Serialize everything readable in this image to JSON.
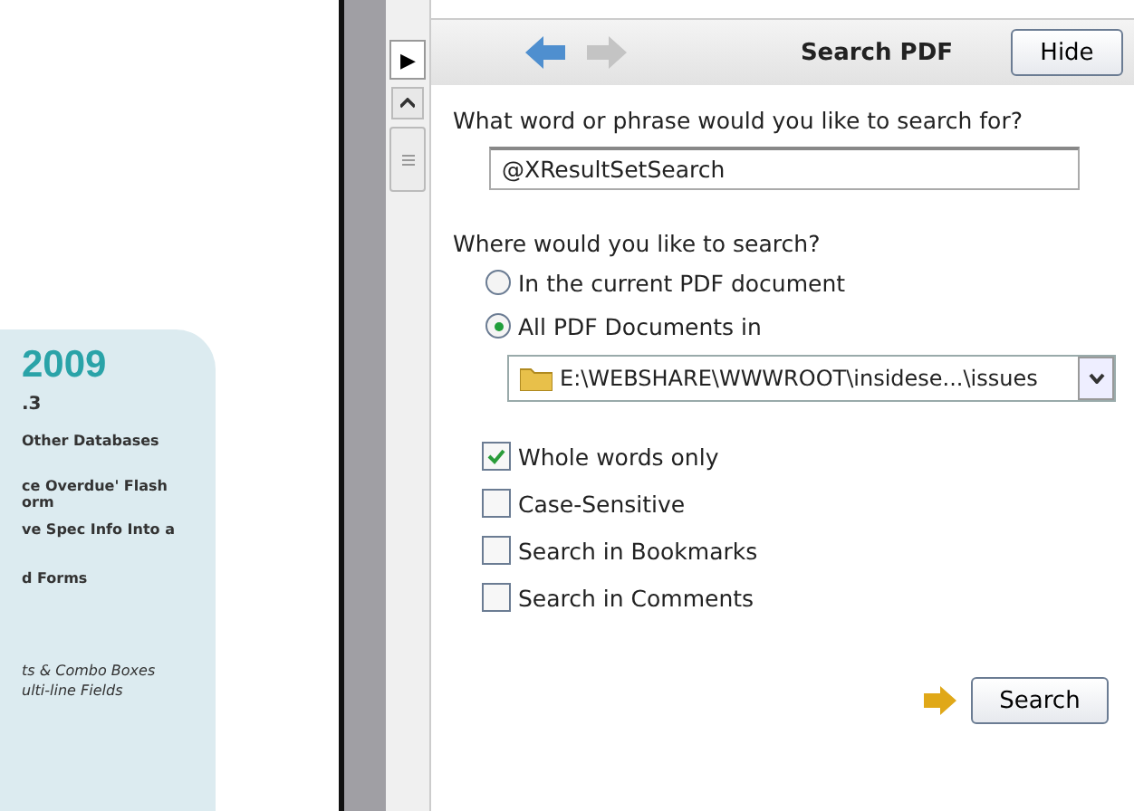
{
  "document_page": {
    "year": "2009",
    "issue": ".3",
    "items": [
      {
        "text": "Other Databases",
        "italic": false
      },
      {
        "text": "ce Overdue' Flash",
        "italic": false
      },
      {
        "text": "orm",
        "italic": false
      },
      {
        "text": "ve Spec Info Into a",
        "italic": false
      },
      {
        "text": "d Forms",
        "italic": false
      },
      {
        "text": "ts & Combo Boxes",
        "italic": true
      },
      {
        "text": "ulti-line Fields",
        "italic": true
      }
    ]
  },
  "panel_toggle": "▶",
  "search_panel": {
    "title": "Search PDF",
    "hide_button": "Hide",
    "query_label": "What word or phrase would you like to search for?",
    "query_value": "@XResultSetSearch",
    "where_label": "Where would you like to search?",
    "scope": [
      {
        "label": "In the current PDF document",
        "selected": false
      },
      {
        "label": "All PDF Documents in",
        "selected": true
      }
    ],
    "folder": "E:\\WEBSHARE\\WWWROOT\\insidese...\\issues",
    "options": [
      {
        "label": "Whole words only",
        "checked": true
      },
      {
        "label": "Case-Sensitive",
        "checked": false
      },
      {
        "label": "Search in Bookmarks",
        "checked": false
      },
      {
        "label": "Search in Comments",
        "checked": false
      }
    ],
    "search_button": "Search"
  }
}
